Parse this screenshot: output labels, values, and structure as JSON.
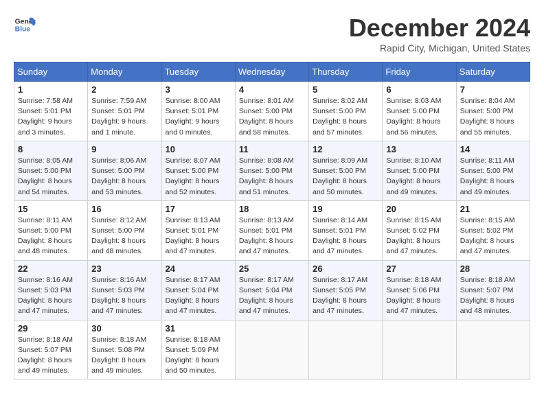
{
  "header": {
    "logo_line1": "General",
    "logo_line2": "Blue",
    "month_title": "December 2024",
    "location": "Rapid City, Michigan, United States"
  },
  "days_of_week": [
    "Sunday",
    "Monday",
    "Tuesday",
    "Wednesday",
    "Thursday",
    "Friday",
    "Saturday"
  ],
  "weeks": [
    [
      {
        "day": "1",
        "sunrise": "7:58 AM",
        "sunset": "5:01 PM",
        "daylight": "9 hours and 3 minutes."
      },
      {
        "day": "2",
        "sunrise": "7:59 AM",
        "sunset": "5:01 PM",
        "daylight": "9 hours and 1 minute."
      },
      {
        "day": "3",
        "sunrise": "8:00 AM",
        "sunset": "5:01 PM",
        "daylight": "9 hours and 0 minutes."
      },
      {
        "day": "4",
        "sunrise": "8:01 AM",
        "sunset": "5:00 PM",
        "daylight": "8 hours and 58 minutes."
      },
      {
        "day": "5",
        "sunrise": "8:02 AM",
        "sunset": "5:00 PM",
        "daylight": "8 hours and 57 minutes."
      },
      {
        "day": "6",
        "sunrise": "8:03 AM",
        "sunset": "5:00 PM",
        "daylight": "8 hours and 56 minutes."
      },
      {
        "day": "7",
        "sunrise": "8:04 AM",
        "sunset": "5:00 PM",
        "daylight": "8 hours and 55 minutes."
      }
    ],
    [
      {
        "day": "8",
        "sunrise": "8:05 AM",
        "sunset": "5:00 PM",
        "daylight": "8 hours and 54 minutes."
      },
      {
        "day": "9",
        "sunrise": "8:06 AM",
        "sunset": "5:00 PM",
        "daylight": "8 hours and 53 minutes."
      },
      {
        "day": "10",
        "sunrise": "8:07 AM",
        "sunset": "5:00 PM",
        "daylight": "8 hours and 52 minutes."
      },
      {
        "day": "11",
        "sunrise": "8:08 AM",
        "sunset": "5:00 PM",
        "daylight": "8 hours and 51 minutes."
      },
      {
        "day": "12",
        "sunrise": "8:09 AM",
        "sunset": "5:00 PM",
        "daylight": "8 hours and 50 minutes."
      },
      {
        "day": "13",
        "sunrise": "8:10 AM",
        "sunset": "5:00 PM",
        "daylight": "8 hours and 49 minutes."
      },
      {
        "day": "14",
        "sunrise": "8:11 AM",
        "sunset": "5:00 PM",
        "daylight": "8 hours and 49 minutes."
      }
    ],
    [
      {
        "day": "15",
        "sunrise": "8:11 AM",
        "sunset": "5:00 PM",
        "daylight": "8 hours and 48 minutes."
      },
      {
        "day": "16",
        "sunrise": "8:12 AM",
        "sunset": "5:00 PM",
        "daylight": "8 hours and 48 minutes."
      },
      {
        "day": "17",
        "sunrise": "8:13 AM",
        "sunset": "5:01 PM",
        "daylight": "8 hours and 47 minutes."
      },
      {
        "day": "18",
        "sunrise": "8:13 AM",
        "sunset": "5:01 PM",
        "daylight": "8 hours and 47 minutes."
      },
      {
        "day": "19",
        "sunrise": "8:14 AM",
        "sunset": "5:01 PM",
        "daylight": "8 hours and 47 minutes."
      },
      {
        "day": "20",
        "sunrise": "8:15 AM",
        "sunset": "5:02 PM",
        "daylight": "8 hours and 47 minutes."
      },
      {
        "day": "21",
        "sunrise": "8:15 AM",
        "sunset": "5:02 PM",
        "daylight": "8 hours and 47 minutes."
      }
    ],
    [
      {
        "day": "22",
        "sunrise": "8:16 AM",
        "sunset": "5:03 PM",
        "daylight": "8 hours and 47 minutes."
      },
      {
        "day": "23",
        "sunrise": "8:16 AM",
        "sunset": "5:03 PM",
        "daylight": "8 hours and 47 minutes."
      },
      {
        "day": "24",
        "sunrise": "8:17 AM",
        "sunset": "5:04 PM",
        "daylight": "8 hours and 47 minutes."
      },
      {
        "day": "25",
        "sunrise": "8:17 AM",
        "sunset": "5:04 PM",
        "daylight": "8 hours and 47 minutes."
      },
      {
        "day": "26",
        "sunrise": "8:17 AM",
        "sunset": "5:05 PM",
        "daylight": "8 hours and 47 minutes."
      },
      {
        "day": "27",
        "sunrise": "8:18 AM",
        "sunset": "5:06 PM",
        "daylight": "8 hours and 47 minutes."
      },
      {
        "day": "28",
        "sunrise": "8:18 AM",
        "sunset": "5:07 PM",
        "daylight": "8 hours and 48 minutes."
      }
    ],
    [
      {
        "day": "29",
        "sunrise": "8:18 AM",
        "sunset": "5:07 PM",
        "daylight": "8 hours and 49 minutes."
      },
      {
        "day": "30",
        "sunrise": "8:18 AM",
        "sunset": "5:08 PM",
        "daylight": "8 hours and 49 minutes."
      },
      {
        "day": "31",
        "sunrise": "8:18 AM",
        "sunset": "5:09 PM",
        "daylight": "8 hours and 50 minutes."
      },
      null,
      null,
      null,
      null
    ]
  ]
}
